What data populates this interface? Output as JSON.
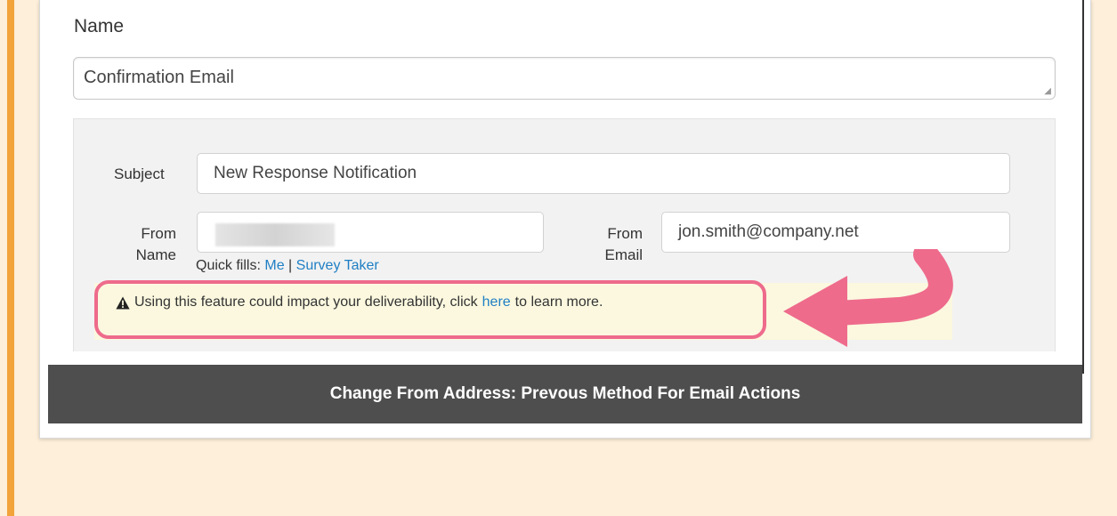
{
  "name": {
    "label": "Name",
    "value": "Confirmation Email"
  },
  "subject": {
    "label": "Subject",
    "value": "New Response Notification"
  },
  "from_name": {
    "label_line1": "From",
    "label_line2": "Name",
    "value": ""
  },
  "from_email": {
    "label_line1": "From",
    "label_line2": "Email",
    "value": "jon.smith@company.net"
  },
  "quick_fills": {
    "label": "Quick fills:",
    "me": "Me",
    "separator": "|",
    "survey_taker": "Survey Taker"
  },
  "warning": {
    "icon": "warning-triangle-icon",
    "text_before": "Using this feature could impact your deliverability, click",
    "link": "here",
    "text_after": "to learn more."
  },
  "caption": "Change From Address: Prevous Method For Email Actions",
  "colors": {
    "page_background": "#fdefd9",
    "accent_bar": "#f2a33a",
    "link": "#1f7fc4",
    "highlight": "#ee6b8c",
    "caption_background": "#4e4e4e"
  }
}
